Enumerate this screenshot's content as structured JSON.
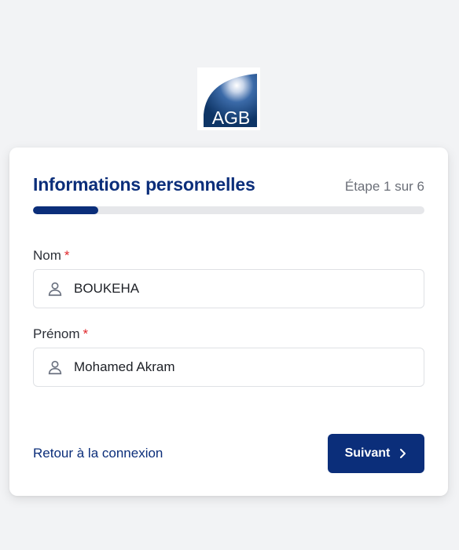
{
  "logo": {
    "text": "AGB",
    "colors": {
      "primary": "#0e3566",
      "highlight": "#ffffff"
    }
  },
  "form": {
    "title": "Informations personnelles",
    "step_label": "Étape 1 sur 6",
    "progress": {
      "current_step": 1,
      "total_steps": 6,
      "fraction": 0.1667
    },
    "fields": {
      "nom": {
        "label": "Nom",
        "required_mark": "*",
        "value": "BOUKEHA",
        "icon": "user-icon"
      },
      "prenom": {
        "label": "Prénom",
        "required_mark": "*",
        "value": "Mohamed Akram",
        "icon": "user-icon"
      }
    },
    "back_link_label": "Retour à la connexion",
    "next_button_label": "Suivant",
    "next_button_icon": "chevron-right-icon"
  },
  "colors": {
    "accent": "#0b2e7a",
    "required": "#e0262b",
    "background": "#f2f3f5"
  }
}
